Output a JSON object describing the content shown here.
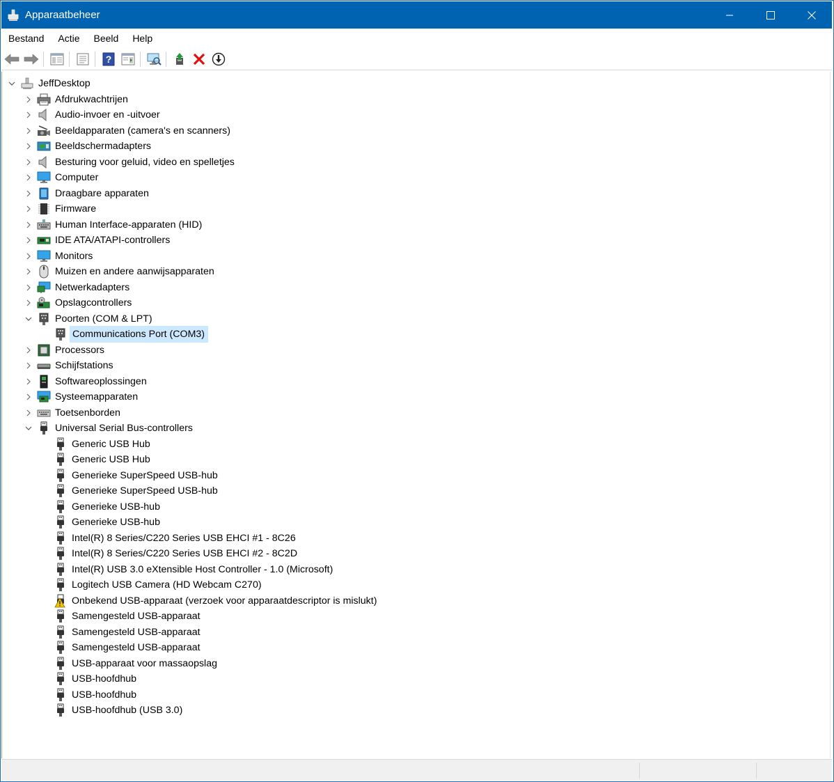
{
  "window": {
    "title": "Apparaatbeheer"
  },
  "menubar": {
    "items": [
      "Bestand",
      "Actie",
      "Beeld",
      "Help"
    ]
  },
  "toolbar": {
    "buttons": [
      "back-icon",
      "forward-icon",
      "console-tree-icon",
      "properties-icon",
      "help-icon",
      "action-pane-icon",
      "scan-hardware-icon",
      "update-driver-icon",
      "uninstall-icon",
      "disable-icon"
    ]
  },
  "tree": {
    "root": "JeffDesktop",
    "categories": [
      {
        "label": "Afdrukwachtrijen",
        "icon": "printer-icon",
        "expanded": false
      },
      {
        "label": "Audio-invoer en -uitvoer",
        "icon": "speaker-icon",
        "expanded": false
      },
      {
        "label": "Beeldapparaten (camera's en scanners)",
        "icon": "camera-icon",
        "expanded": false
      },
      {
        "label": "Beeldschermadapters",
        "icon": "display-adapter-icon",
        "expanded": false
      },
      {
        "label": "Besturing voor geluid, video en spelletjes",
        "icon": "speaker-icon",
        "expanded": false
      },
      {
        "label": "Computer",
        "icon": "computer-icon",
        "expanded": false
      },
      {
        "label": "Draagbare apparaten",
        "icon": "portable-device-icon",
        "expanded": false
      },
      {
        "label": "Firmware",
        "icon": "firmware-icon",
        "expanded": false
      },
      {
        "label": "Human Interface-apparaten (HID)",
        "icon": "hid-icon",
        "expanded": false
      },
      {
        "label": "IDE ATA/ATAPI-controllers",
        "icon": "ide-controller-icon",
        "expanded": false
      },
      {
        "label": "Monitors",
        "icon": "monitor-icon",
        "expanded": false
      },
      {
        "label": "Muizen en andere aanwijsapparaten",
        "icon": "mouse-icon",
        "expanded": false
      },
      {
        "label": "Netwerkadapters",
        "icon": "network-adapter-icon",
        "expanded": false
      },
      {
        "label": "Opslagcontrollers",
        "icon": "storage-controller-icon",
        "expanded": false
      },
      {
        "label": "Poorten (COM & LPT)",
        "icon": "port-icon",
        "expanded": true,
        "children": [
          {
            "label": "Communications Port (COM3)",
            "icon": "port-icon",
            "selected": true
          }
        ]
      },
      {
        "label": "Processors",
        "icon": "processor-icon",
        "expanded": false
      },
      {
        "label": "Schijfstations",
        "icon": "disk-drive-icon",
        "expanded": false
      },
      {
        "label": "Softwareoplossingen",
        "icon": "software-icon",
        "expanded": false
      },
      {
        "label": "Systeemapparaten",
        "icon": "system-device-icon",
        "expanded": false
      },
      {
        "label": "Toetsenborden",
        "icon": "keyboard-icon",
        "expanded": false
      },
      {
        "label": "Universal Serial Bus-controllers",
        "icon": "usb-icon",
        "expanded": true,
        "children": [
          {
            "label": "Generic USB Hub",
            "icon": "usb-icon"
          },
          {
            "label": "Generic USB Hub",
            "icon": "usb-icon"
          },
          {
            "label": "Generieke SuperSpeed USB-hub",
            "icon": "usb-icon"
          },
          {
            "label": "Generieke SuperSpeed USB-hub",
            "icon": "usb-icon"
          },
          {
            "label": "Generieke USB-hub",
            "icon": "usb-icon"
          },
          {
            "label": "Generieke USB-hub",
            "icon": "usb-icon"
          },
          {
            "label": "Intel(R) 8 Series/C220 Series USB EHCI #1 - 8C26",
            "icon": "usb-icon"
          },
          {
            "label": "Intel(R) 8 Series/C220 Series USB EHCI #2 - 8C2D",
            "icon": "usb-icon"
          },
          {
            "label": "Intel(R) USB 3.0 eXtensible Host Controller - 1.0 (Microsoft)",
            "icon": "usb-icon"
          },
          {
            "label": "Logitech USB Camera (HD Webcam C270)",
            "icon": "usb-icon"
          },
          {
            "label": "Onbekend USB-apparaat (verzoek voor apparaatdescriptor is mislukt)",
            "icon": "warning-icon"
          },
          {
            "label": "Samengesteld USB-apparaat",
            "icon": "usb-icon"
          },
          {
            "label": "Samengesteld USB-apparaat",
            "icon": "usb-icon"
          },
          {
            "label": "Samengesteld USB-apparaat",
            "icon": "usb-icon"
          },
          {
            "label": "USB-apparaat voor massaopslag",
            "icon": "usb-icon"
          },
          {
            "label": "USB-hoofdhub",
            "icon": "usb-icon"
          },
          {
            "label": "USB-hoofdhub",
            "icon": "usb-icon"
          },
          {
            "label": "USB-hoofdhub (USB 3.0)",
            "icon": "usb-icon"
          }
        ]
      }
    ]
  },
  "colors": {
    "titlebar": "#0063b1",
    "selection": "#cce8ff"
  }
}
